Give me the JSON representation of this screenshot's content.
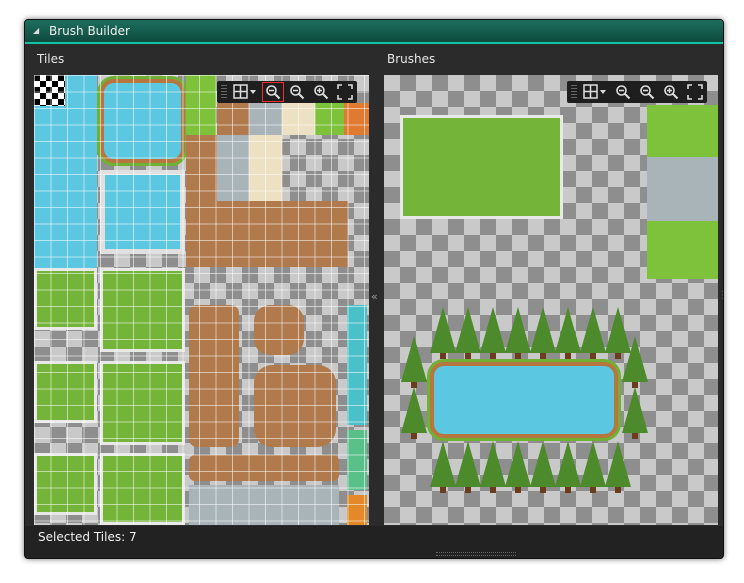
{
  "window": {
    "title": "Brush Builder"
  },
  "panels": {
    "tiles": {
      "label": "Tiles"
    },
    "brushes": {
      "label": "Brushes"
    }
  },
  "toolbar": {
    "buttons": [
      {
        "name": "grid-toggle",
        "icon": "grid-icon"
      },
      {
        "name": "zoom-reset",
        "icon": "zoom-reset-icon"
      },
      {
        "name": "zoom-out",
        "icon": "zoom-out-icon"
      },
      {
        "name": "zoom-in",
        "icon": "zoom-in-icon"
      },
      {
        "name": "fullscreen",
        "icon": "fullscreen-icon"
      }
    ]
  },
  "status": {
    "text": "Selected Tiles: 7"
  },
  "colors": {
    "title_accent": "#12c2a0",
    "selection": "#ff2a2a",
    "water": "#5bc7e0",
    "grass": "#7dc23a",
    "dirt": "#b07a4c"
  }
}
